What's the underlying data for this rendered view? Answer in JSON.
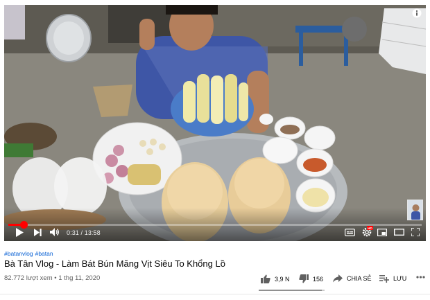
{
  "player": {
    "time_display": "0:31 / 13:58",
    "progress_fraction": 0.037
  },
  "hashtags": [
    "#batanvlog",
    "#batan"
  ],
  "video": {
    "title": "Bà Tân Vlog - Làm Bát Bún Măng Vịt Siêu To Khổng Lồ",
    "views": "82.772 lượt xem",
    "separator": "•",
    "date": "1 thg 11, 2020"
  },
  "actions": {
    "like_count": "3,9 N",
    "dislike_count": "156",
    "share_label": "CHIA SẺ",
    "save_label": "LƯU"
  },
  "sentiment": {
    "like_fraction": 0.96
  },
  "colors": {
    "accent": "#ff0000",
    "link": "#065fd4",
    "meta": "#606060"
  }
}
